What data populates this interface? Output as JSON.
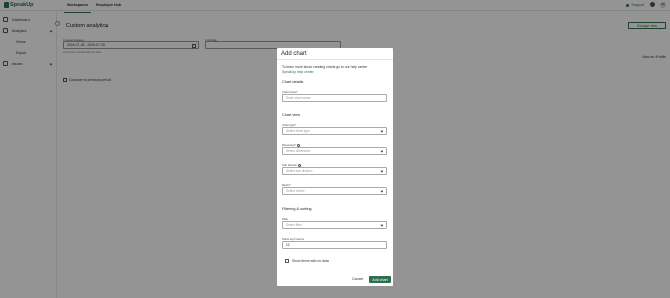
{
  "app": {
    "logo_text": "SpeakUp",
    "brand_color": "#2f6f4f"
  },
  "topnav": {
    "tabs": [
      "Workspaces",
      "Employee Hub"
    ],
    "active_tab": "Workspaces",
    "support_label": "Support",
    "avatar_initials": "AC"
  },
  "sidebar": {
    "items": [
      {
        "label": "Dashboard",
        "icon": "grid-icon"
      },
      {
        "label": "Analytics",
        "icon": "chart-icon"
      },
      {
        "label": "Issues",
        "icon": "list-icon"
      }
    ],
    "analytics_sub": [
      "Views",
      "Export"
    ]
  },
  "main": {
    "title": "Custom analytics",
    "manage_button": "Manage view",
    "created_between_label": "Created between",
    "date_range": "2024-07-28 - 2025-07-28",
    "date_hint": "Only charts created with the data",
    "date_label": "Until date",
    "view_as": "View as: iProfile",
    "compare_label": "Compare to previous period"
  },
  "modal": {
    "title": "Add chart",
    "intro_text": "To learn more about creating charts go to our help center",
    "intro_link": "SpeakUp help center.",
    "section_details": "Chart details",
    "chart_name_label": "Chart name*",
    "chart_name_placeholder": "Enter chart name",
    "section_view": "Chart view",
    "chart_type_label": "Chart type*",
    "chart_type_placeholder": "Select chart type",
    "dimension_label": "Dimension*",
    "dimension_placeholder": "Select dimension",
    "sub_division_label": "Sub division",
    "sub_division_placeholder": "Select sub division",
    "metric_label": "Metric*",
    "metric_placeholder": "Select metric",
    "section_filter": "Filtering & sorting",
    "filter_label": "Filter",
    "filter_placeholder": "Select filter",
    "show_top_label": "Show top N items",
    "show_top_value": "12",
    "show_empty_label": "Show items with no data",
    "cancel_label": "Cancel",
    "add_label": "Add chart"
  }
}
